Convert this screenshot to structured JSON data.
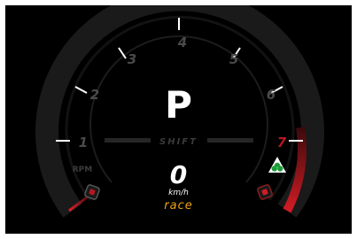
{
  "dashboard": {
    "gear": "P",
    "shift_label": "SHIFT",
    "speed": "0",
    "speed_unit": "km/h",
    "drive_mode": "race",
    "rpm_label": "RPM",
    "rpm_scale_labels": [
      "1",
      "2",
      "3",
      "4",
      "5",
      "6",
      "7"
    ],
    "left_badge_icon": "temperature-badge-icon",
    "right_badge_icon": "fuel-badge-icon",
    "mode_icon": "quadrifoglio-icon"
  },
  "colors": {
    "background": "#000000",
    "accent": "#f0a412",
    "redline": "#d11c24",
    "tick": "#ffffff",
    "scale_number": "#4a4a4a"
  }
}
